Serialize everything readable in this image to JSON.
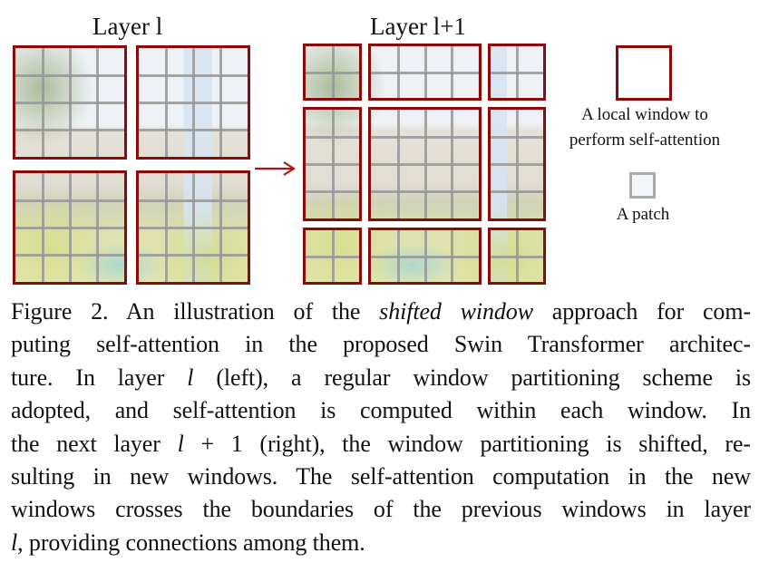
{
  "figure": {
    "left_panel": {
      "title": "Layer l",
      "window_grid": "2x2",
      "patches_per_window": "4x4"
    },
    "right_panel": {
      "title": "Layer l+1",
      "window_grid": "3x3 (shifted)",
      "window_patch_counts": [
        [
          "2x2",
          "4x2",
          "2x2"
        ],
        [
          "2x4",
          "4x4",
          "2x4"
        ],
        [
          "2x2",
          "4x2",
          "2x2"
        ]
      ]
    },
    "arrow_icon": "right-arrow-icon",
    "colors": {
      "window_border": "#8b0a0a",
      "patch_line": "#969696",
      "arrow": "#b01515"
    },
    "legend": {
      "window_label_line1": "A local window to",
      "window_label_line2": "perform self-attention",
      "patch_label": "A patch"
    }
  },
  "caption": {
    "lines": [
      {
        "parts": [
          "Figure 2. An illustration of the ",
          "shifted window",
          " approach for com-"
        ]
      },
      {
        "text": "puting self-attention in the proposed Swin Transformer architec-"
      },
      {
        "parts": [
          "ture.  In layer ",
          "l",
          " (left), a regular window partitioning scheme is"
        ]
      },
      {
        "text": "adopted, and self-attention is computed within each window.  In"
      },
      {
        "parts": [
          "the next layer ",
          "l",
          " + 1 (right), the window partitioning is shifted, re-"
        ]
      },
      {
        "text": "sulting in new windows. The self-attention computation in the new"
      },
      {
        "text": "windows crosses the boundaries of the previous windows in layer"
      },
      {
        "parts": [
          "",
          "l",
          ", providing connections among them."
        ]
      }
    ]
  }
}
